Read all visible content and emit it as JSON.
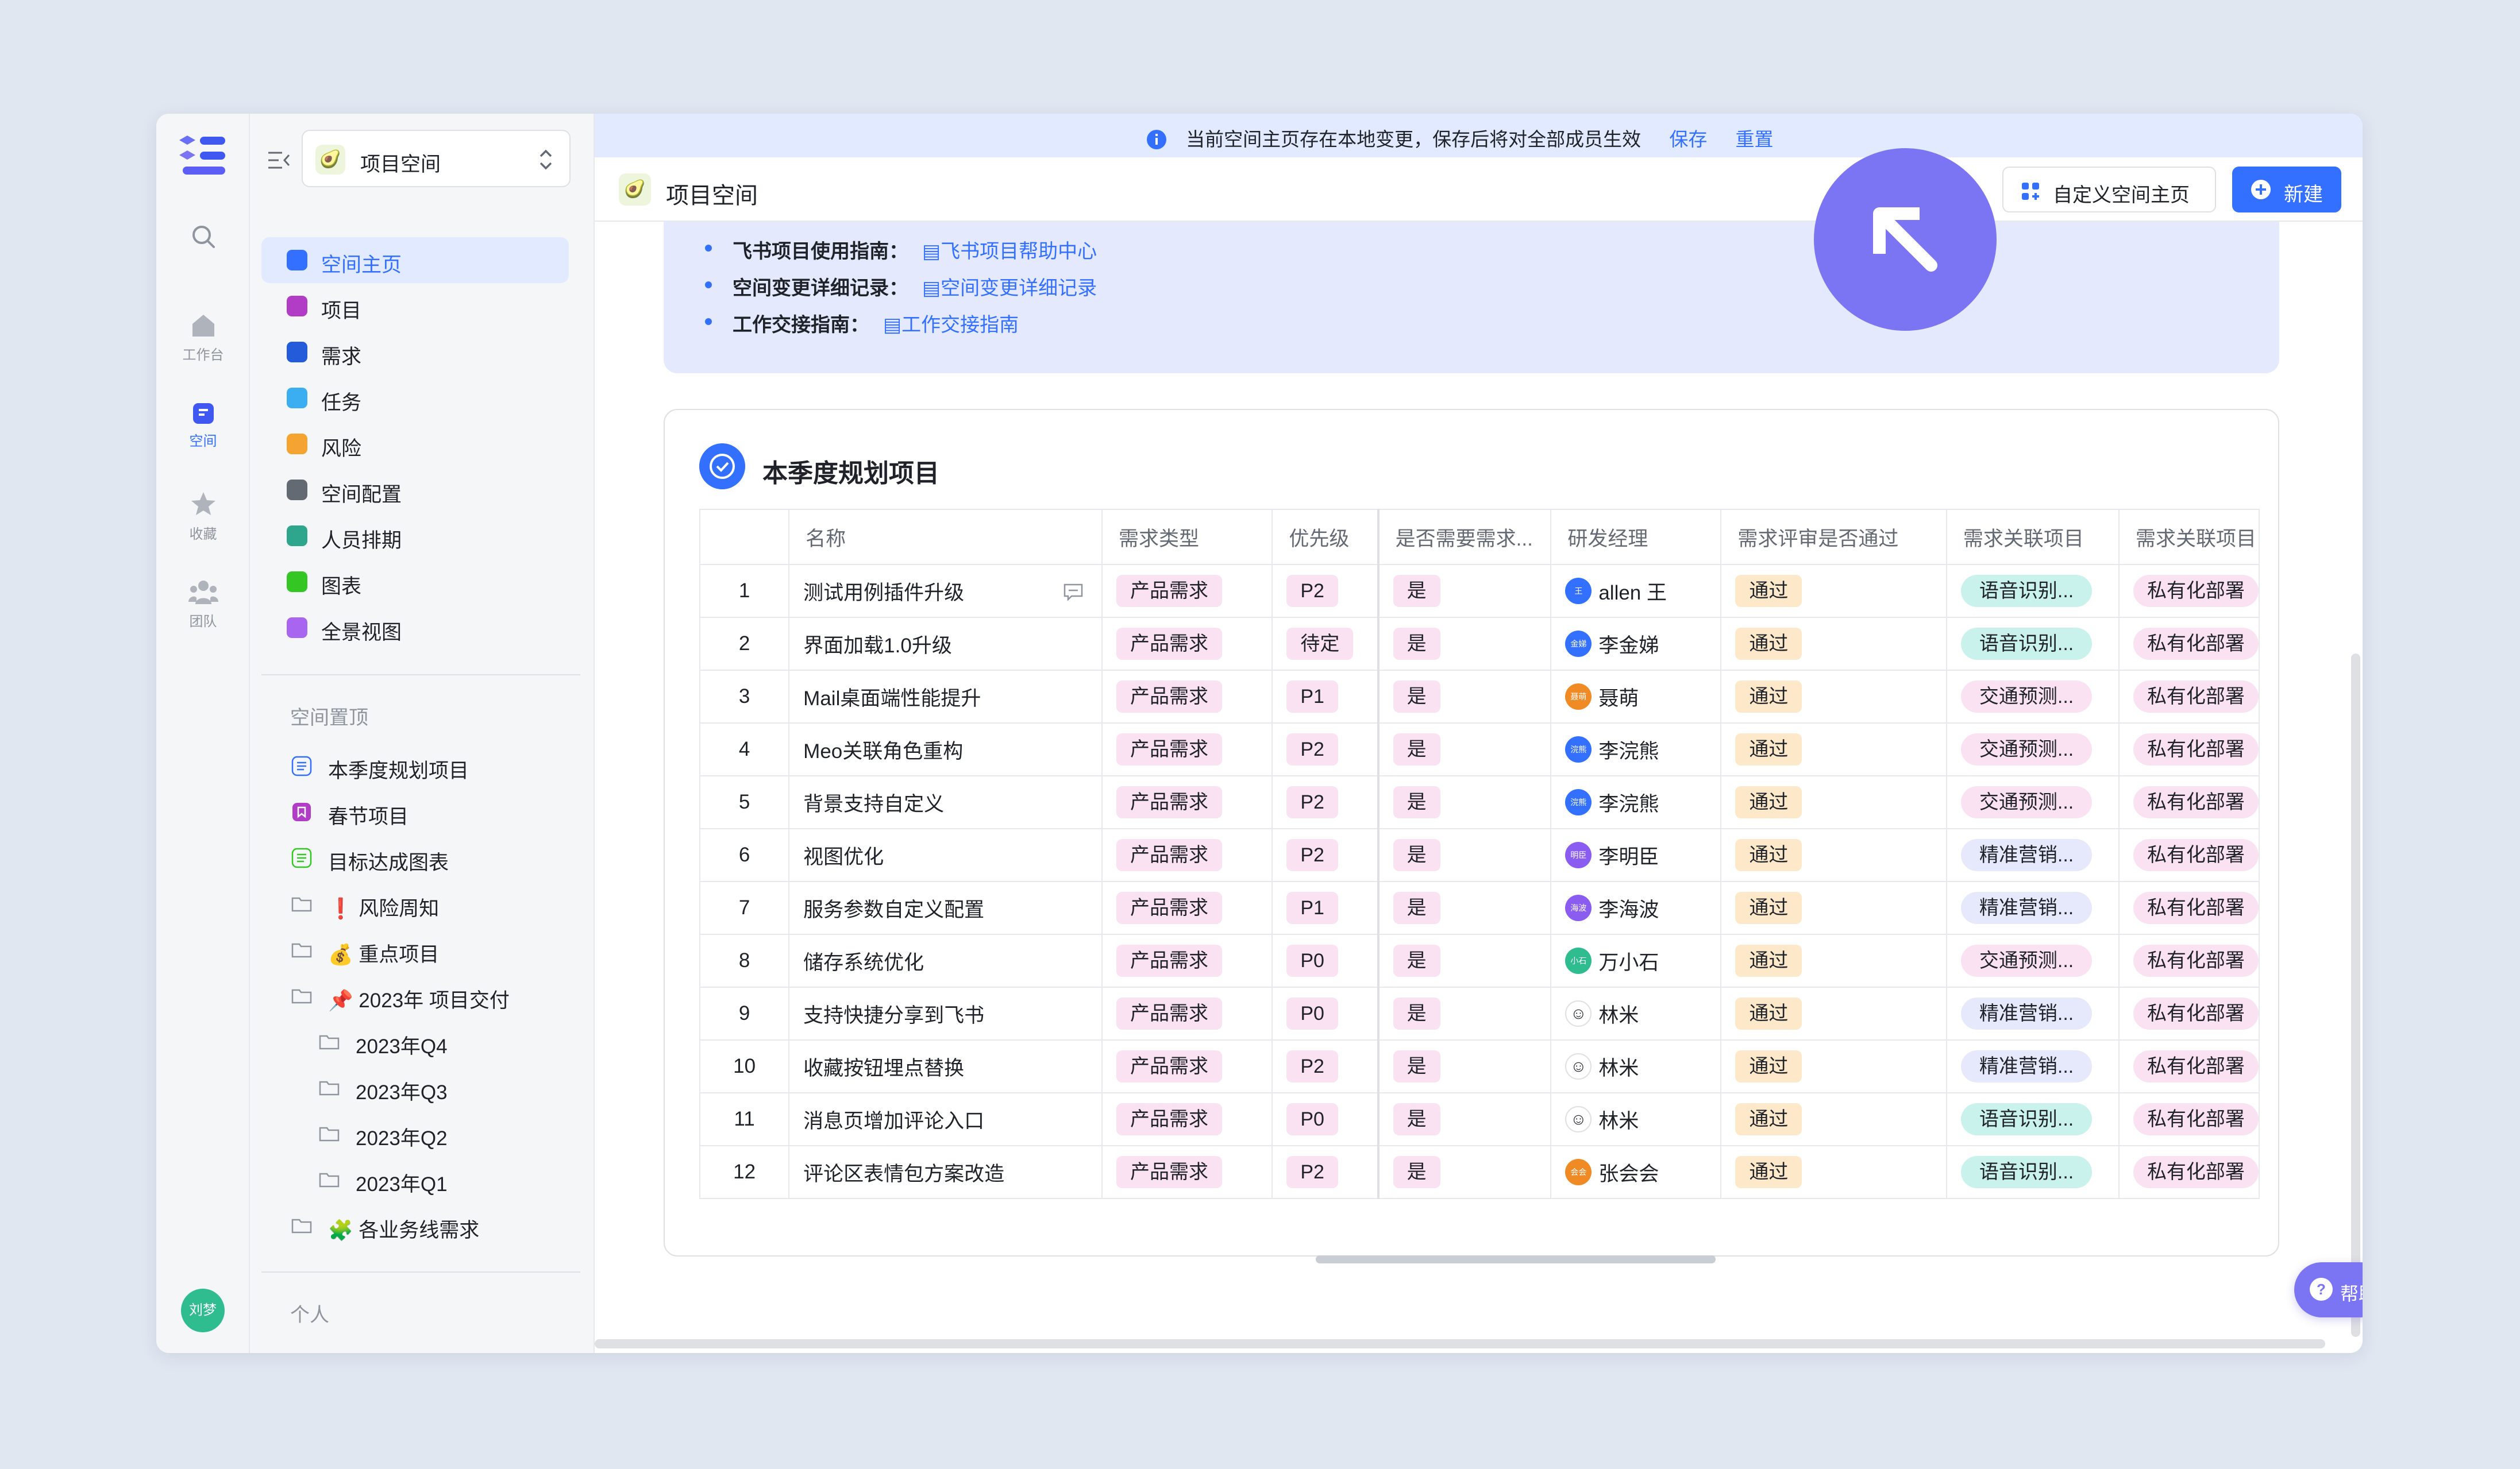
{
  "rail": {
    "items": [
      {
        "label": "",
        "icon": "search-icon"
      },
      {
        "label": "工作台",
        "icon": "home-icon"
      },
      {
        "label": "空间",
        "icon": "space-icon",
        "active": true
      },
      {
        "label": "收藏",
        "icon": "star-icon"
      },
      {
        "label": "团队",
        "icon": "team-icon"
      }
    ],
    "avatar": "刘梦"
  },
  "sidebar": {
    "space_name": "项目空间",
    "nav": [
      {
        "label": "空间主页",
        "color": "#3370ff",
        "active": true
      },
      {
        "label": "项目",
        "color": "#b13cc6"
      },
      {
        "label": "需求",
        "color": "#245bdb"
      },
      {
        "label": "任务",
        "color": "#3aaef0"
      },
      {
        "label": "风险",
        "color": "#f5a331"
      },
      {
        "label": "空间配置",
        "color": "#646a73"
      },
      {
        "label": "人员排期",
        "color": "#2ea58d"
      },
      {
        "label": "图表",
        "color": "#34c724"
      },
      {
        "label": "全景视图",
        "color": "#a866f0"
      }
    ],
    "pinned_title": "空间置顶",
    "pinned": [
      {
        "label": "本季度规划项目",
        "kind": "list-blue",
        "indent": 0
      },
      {
        "label": "春节项目",
        "kind": "project",
        "indent": 0
      },
      {
        "label": "目标达成图表",
        "kind": "list-green",
        "indent": 0
      },
      {
        "label": "❗ 风险周知",
        "kind": "folder",
        "indent": 0
      },
      {
        "label": "💰 重点项目",
        "kind": "folder",
        "indent": 0
      },
      {
        "label": "📌 2023年 项目交付",
        "kind": "folder",
        "indent": 0
      },
      {
        "label": "2023年Q4",
        "kind": "folder",
        "indent": 1
      },
      {
        "label": "2023年Q3",
        "kind": "folder",
        "indent": 1
      },
      {
        "label": "2023年Q2",
        "kind": "folder",
        "indent": 1
      },
      {
        "label": "2023年Q1",
        "kind": "folder",
        "indent": 1
      },
      {
        "label": "🧩 各业务线需求",
        "kind": "folder",
        "indent": 0
      }
    ],
    "personal_title": "个人"
  },
  "banner": {
    "text": "当前空间主页存在本地变更，保存后将对全部成员生效",
    "save": "保存",
    "reset": "重置"
  },
  "topbar": {
    "title": "项目空间",
    "custom_button": "自定义空间主页",
    "new_button": "新建"
  },
  "guides": [
    {
      "label": "飞书项目使用指南：",
      "link": "飞书项目帮助中心"
    },
    {
      "label": "空间变更详细记录：",
      "link": "空间变更详细记录"
    },
    {
      "label": "工作交接指南：",
      "link": "工作交接指南"
    }
  ],
  "card": {
    "title": "本季度规划项目",
    "columns": [
      "",
      "名称",
      "需求类型",
      "优先级",
      "是否需要需求...",
      "研发经理",
      "需求评审是否通过",
      "需求关联项目",
      "需求关联项目"
    ],
    "rows": [
      {
        "idx": "1",
        "name": "测试用例插件升级",
        "type": "产品需求",
        "priority": "P2",
        "needs": "是",
        "manager": "allen 王",
        "mgr_color": "#3370ff",
        "mgr_initial": "王",
        "review": "通过",
        "proj": "语音识别...",
        "proj_style": "teal",
        "proj2": "私有化部署"
      },
      {
        "idx": "2",
        "name": "界面加载1.0升级",
        "type": "产品需求",
        "priority": "待定",
        "needs": "是",
        "manager": "李金娣",
        "mgr_color": "#3370ff",
        "mgr_initial": "金娣",
        "review": "通过",
        "proj": "语音识别...",
        "proj_style": "teal",
        "proj2": "私有化部署"
      },
      {
        "idx": "3",
        "name": "Mail桌面端性能提升",
        "type": "产品需求",
        "priority": "P1",
        "needs": "是",
        "manager": "聂萌",
        "mgr_color": "#f08a24",
        "mgr_initial": "聂萌",
        "review": "通过",
        "proj": "交通预测...",
        "proj_style": "pink",
        "proj2": "私有化部署"
      },
      {
        "idx": "4",
        "name": "Meo关联角色重构",
        "type": "产品需求",
        "priority": "P2",
        "needs": "是",
        "manager": "李浣熊",
        "mgr_color": "#3370ff",
        "mgr_initial": "浣熊",
        "review": "通过",
        "proj": "交通预测...",
        "proj_style": "pink",
        "proj2": "私有化部署"
      },
      {
        "idx": "5",
        "name": "背景支持自定义",
        "type": "产品需求",
        "priority": "P2",
        "needs": "是",
        "manager": "李浣熊",
        "mgr_color": "#3370ff",
        "mgr_initial": "浣熊",
        "review": "通过",
        "proj": "交通预测...",
        "proj_style": "pink",
        "proj2": "私有化部署"
      },
      {
        "idx": "6",
        "name": "视图优化",
        "type": "产品需求",
        "priority": "P2",
        "needs": "是",
        "manager": "李明臣",
        "mgr_color": "#8a5cf0",
        "mgr_initial": "明臣",
        "review": "通过",
        "proj": "精准营销...",
        "proj_style": "lav",
        "proj2": "私有化部署"
      },
      {
        "idx": "7",
        "name": "服务参数自定义配置",
        "type": "产品需求",
        "priority": "P1",
        "needs": "是",
        "manager": "李海波",
        "mgr_color": "#8a5cf0",
        "mgr_initial": "海波",
        "review": "通过",
        "proj": "精准营销...",
        "proj_style": "lav",
        "proj2": "私有化部署"
      },
      {
        "idx": "8",
        "name": "储存系统优化",
        "type": "产品需求",
        "priority": "P0",
        "needs": "是",
        "manager": "万小石",
        "mgr_color": "#2fbd8f",
        "mgr_initial": "小石",
        "review": "通过",
        "proj": "交通预测...",
        "proj_style": "pink",
        "proj2": "私有化部署"
      },
      {
        "idx": "9",
        "name": "支持快捷分享到飞书",
        "type": "产品需求",
        "priority": "P0",
        "needs": "是",
        "manager": "林米",
        "mgr_color": "#ffffff",
        "mgr_initial": "",
        "review": "通过",
        "proj": "精准营销...",
        "proj_style": "lav",
        "proj2": "私有化部署"
      },
      {
        "idx": "10",
        "name": "收藏按钮埋点替换",
        "type": "产品需求",
        "priority": "P2",
        "needs": "是",
        "manager": "林米",
        "mgr_color": "#ffffff",
        "mgr_initial": "",
        "review": "通过",
        "proj": "精准营销...",
        "proj_style": "lav",
        "proj2": "私有化部署"
      },
      {
        "idx": "11",
        "name": "消息页增加评论入口",
        "type": "产品需求",
        "priority": "P0",
        "needs": "是",
        "manager": "林米",
        "mgr_color": "#ffffff",
        "mgr_initial": "",
        "review": "通过",
        "proj": "语音识别...",
        "proj_style": "teal",
        "proj2": "私有化部署"
      },
      {
        "idx": "12",
        "name": "评论区表情包方案改造",
        "type": "产品需求",
        "priority": "P2",
        "needs": "是",
        "manager": "张会会",
        "mgr_color": "#f08a24",
        "mgr_initial": "会会",
        "review": "通过",
        "proj": "语音识别...",
        "proj_style": "teal",
        "proj2": "私有化部署"
      }
    ]
  },
  "help": {
    "label": "帮助"
  }
}
